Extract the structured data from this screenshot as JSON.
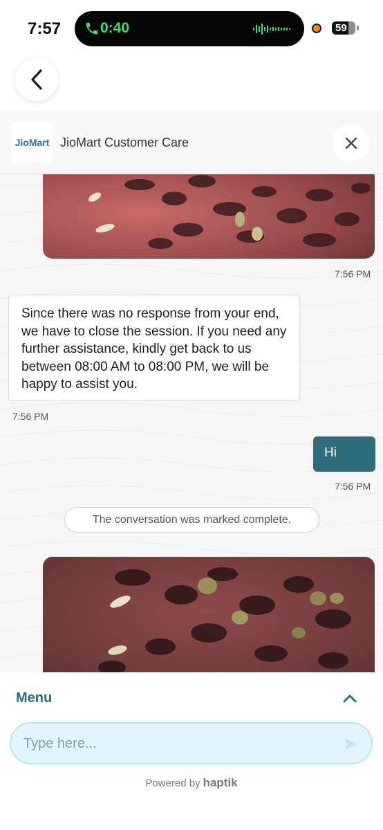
{
  "status_bar": {
    "time": "7:57",
    "call_duration": "0:40",
    "battery": "59"
  },
  "header": {
    "logo_text": "JioMart",
    "title": "JioMart Customer Care"
  },
  "messages": {
    "image_1_time": "7:56 PM",
    "agent_text": "Since there was no response from your end, we have to close the session. If you need any further assistance, kindly get back to us between 08:00 AM to 08:00 PM, we will be happy to assist you.",
    "agent_time": "7:56 PM",
    "user_text": "Hi",
    "user_time": "7:56 PM",
    "system_notice": "The conversation was marked complete."
  },
  "footer": {
    "menu_label": "Menu",
    "input_placeholder": "Type here...",
    "powered_by": "Powered by",
    "powered_brand": "haptik"
  },
  "icons": {
    "back": "chevron-left-icon",
    "close": "close-icon",
    "menu_toggle": "chevron-up-icon",
    "send": "send-icon",
    "call": "phone-icon"
  },
  "colors": {
    "accent": "#2e6e7e",
    "user_bubble": "#2e6e7e",
    "input_bg": "#dff5fb",
    "call_green": "#3ee06b"
  }
}
